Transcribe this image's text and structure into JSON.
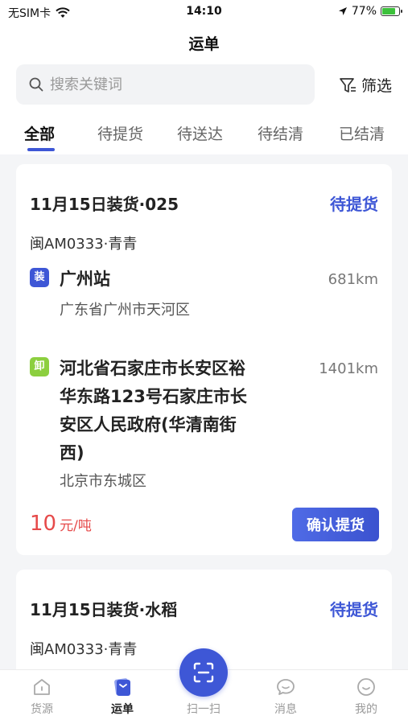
{
  "status_bar": {
    "carrier": "无SIM卡",
    "time": "14:10",
    "battery": "77%"
  },
  "header": {
    "title": "运单"
  },
  "search": {
    "placeholder": "搜索关键词",
    "filter_label": "筛选"
  },
  "tabs": [
    {
      "label": "全部",
      "active": true
    },
    {
      "label": "待提货",
      "active": false
    },
    {
      "label": "待送达",
      "active": false
    },
    {
      "label": "待结清",
      "active": false
    },
    {
      "label": "已结清",
      "active": false
    }
  ],
  "orders": [
    {
      "title": "11月15日装货·025",
      "status": "待提货",
      "plate": "闽AM0333·青青",
      "load": {
        "tag": "装",
        "place": "广州站",
        "region": "广东省广州市天河区",
        "distance": "681km"
      },
      "unload": {
        "tag": "卸",
        "place_lines": [
          "河北省石家庄市长安区裕",
          "华东路123号石家庄市长",
          "安区人民政府(华清南街",
          "西)"
        ],
        "region": "北京市东城区",
        "distance": "1401km"
      },
      "price": "10",
      "price_unit": "元/吨",
      "action": "确认提货"
    },
    {
      "title": "11月15日装货·水稻",
      "status": "待提货",
      "plate": "闽AM0333·青青"
    }
  ],
  "bottom_nav": {
    "items": [
      {
        "label": "货源",
        "icon": "home-icon"
      },
      {
        "label": "运单",
        "icon": "waybill-icon",
        "active": true
      },
      {
        "label": "扫一扫",
        "icon": "scan-icon"
      },
      {
        "label": "消息",
        "icon": "message-icon"
      },
      {
        "label": "我的",
        "icon": "profile-icon"
      }
    ]
  },
  "colors": {
    "accent": "#3e57d6",
    "price": "#e64a4a",
    "unload_tag": "#8ccf3f"
  }
}
